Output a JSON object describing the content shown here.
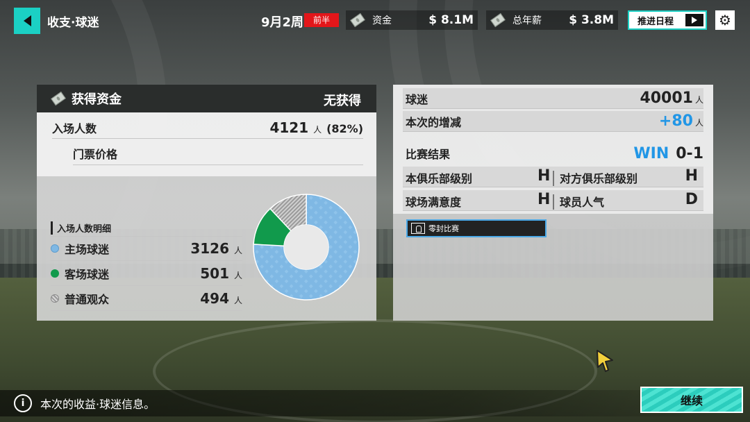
{
  "header": {
    "title": "收支·球迷",
    "week": "9月2周",
    "half_badge": "前半",
    "funds_label": "资金",
    "funds_value": "$ 8.1M",
    "salary_label": "总年薪",
    "salary_value": "$ 3.8M",
    "advance_label": "推进日程"
  },
  "income_panel": {
    "title": "获得资金",
    "status": "无获得",
    "attendance_label": "入场人数",
    "attendance_value": "4121",
    "attendance_unit": "人",
    "attendance_pct": "(82%)",
    "ticket_label": "门票价格",
    "breakdown_title": "入场人数明细",
    "breakdown": [
      {
        "label": "主场球迷",
        "value": "3126",
        "unit": "人"
      },
      {
        "label": "客场球迷",
        "value": "501",
        "unit": "人"
      },
      {
        "label": "普通观众",
        "value": "494",
        "unit": "人"
      }
    ],
    "chart_colors": {
      "home": "#7fb8e4",
      "away": "#119a4c",
      "general": "#a8a8a8"
    }
  },
  "fans_panel": {
    "fans_label": "球迷",
    "fans_value": "40001",
    "fans_unit": "人",
    "change_label": "本次的增减",
    "change_value": "+80",
    "change_unit": "人",
    "result_label": "比赛结果",
    "result_outcome": "WIN",
    "result_score": "0-1",
    "club_level_label": "本俱乐部级别",
    "club_level_value": "H",
    "opp_level_label": "对方俱乐部级别",
    "opp_level_value": "H",
    "stadium_label": "球场满意度",
    "stadium_value": "H",
    "popularity_label": "球员人气",
    "popularity_value": "D",
    "bonus_label": "零封比赛"
  },
  "footer": {
    "message": "本次的收益·球迷信息。",
    "continue_label": "继续"
  }
}
